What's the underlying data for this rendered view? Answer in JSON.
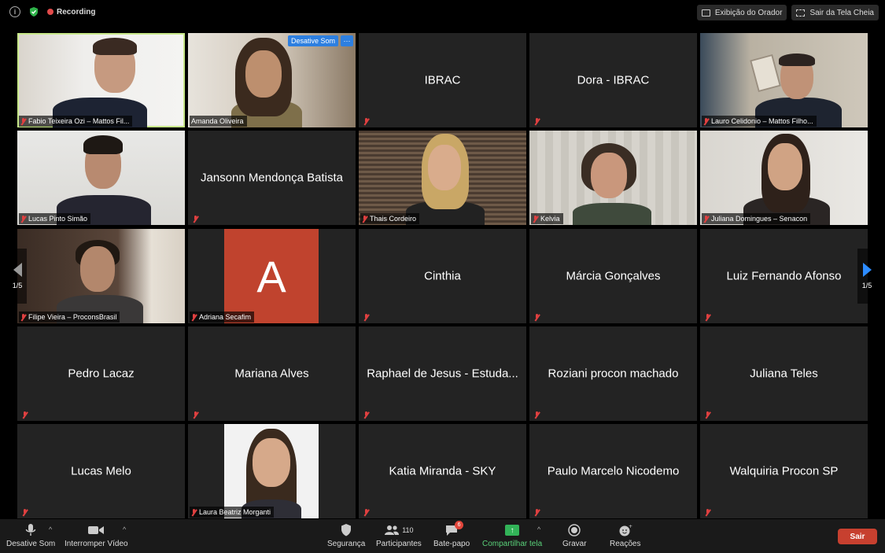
{
  "topbar": {
    "recording_label": "Recording",
    "speaker_view_label": "Exibição do Orador",
    "exit_fullscreen_label": "Sair da Tela Cheia"
  },
  "tiles": [
    {
      "name": "Fabio Teixeira Ozi – Mattos Fil...",
      "video": true
    },
    {
      "name": "Amanda Oliveira",
      "video": true,
      "unmute_label": "Desative Som",
      "more_label": "···"
    },
    {
      "name": "IBRAC",
      "video": false
    },
    {
      "name": "Dora - IBRAC",
      "video": false
    },
    {
      "name": "Lauro Celidonio – Mattos Filho...",
      "video": true
    },
    {
      "name": "Lucas Pinto Simão",
      "video": true
    },
    {
      "name": "Jansonn Mendonça Batista",
      "video": false
    },
    {
      "name": "Thais Cordeiro",
      "video": true
    },
    {
      "name": "Kelvia",
      "video": true
    },
    {
      "name": "Juliana Domingues – Senacon",
      "video": true
    },
    {
      "name": "Filipe Vieira – ProconsBrasil",
      "video": true
    },
    {
      "name": "Adriana Secafim",
      "video": false,
      "avatar_letter": "A"
    },
    {
      "name": "Cinthia",
      "video": false
    },
    {
      "name": "Márcia Gonçalves",
      "video": false
    },
    {
      "name": "Luiz Fernando Afonso",
      "video": false
    },
    {
      "name": "Pedro Lacaz",
      "video": false
    },
    {
      "name": "Mariana Alves",
      "video": false
    },
    {
      "name": "Raphael de Jesus - Estuda...",
      "video": false
    },
    {
      "name": "Roziani procon machado",
      "video": false
    },
    {
      "name": "Juliana Teles",
      "video": false
    },
    {
      "name": "Lucas Melo",
      "video": false
    },
    {
      "name": "Laura Beatriz Morganti",
      "video": true
    },
    {
      "name": "Katia Miranda - SKY",
      "video": false
    },
    {
      "name": "Paulo Marcelo Nicodemo",
      "video": false
    },
    {
      "name": "Walquiria Procon SP",
      "video": false
    }
  ],
  "pager": {
    "left": "1/5",
    "right": "1/5"
  },
  "toolbar": {
    "mute": "Desative Som",
    "video": "Interromper Vídeo",
    "security": "Segurança",
    "participants": "Participantes",
    "participants_count": "110",
    "chat": "Bate-papo",
    "chat_badge": "6",
    "share": "Compartilhar tela",
    "record": "Gravar",
    "reactions": "Reações",
    "leave": "Sair"
  },
  "colors": {
    "accent": "#2d8cff",
    "leave": "#c7402f",
    "share": "#32b358",
    "active_speaker": "#c8e88a",
    "avatar": "#c0432e"
  }
}
